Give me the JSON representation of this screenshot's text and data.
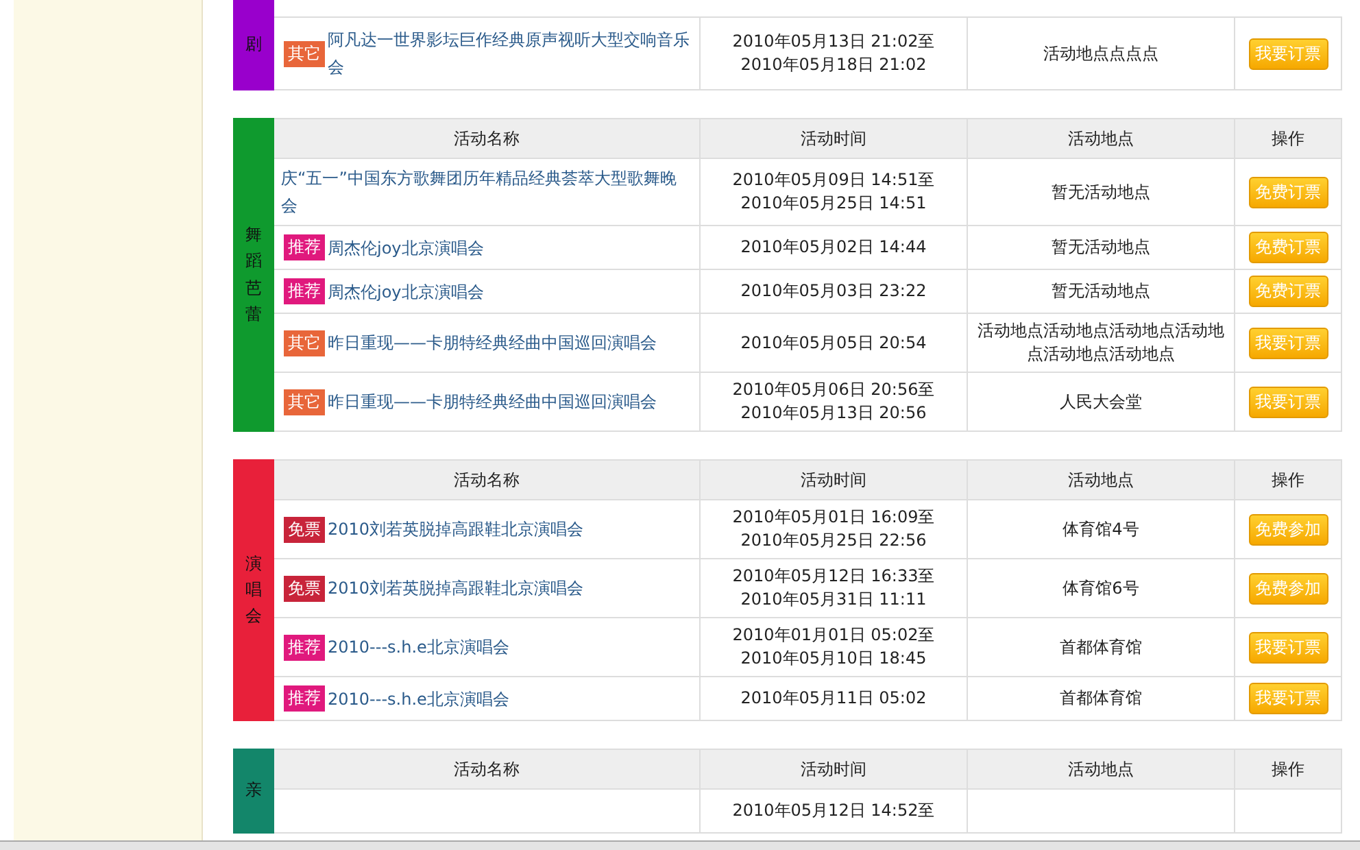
{
  "sections": [
    {
      "category": "剧",
      "color": "#9900cc",
      "rows": [
        {
          "tag": "其它",
          "color": "#e8663a",
          "name": "阿凡达一世界影坛巨作经典原声视听大型交响音乐会",
          "time": [
            "2010年05月13日 21:02至",
            "2010年05月18日 21:02"
          ],
          "place": "活动地点点点点",
          "button": "我要订票"
        }
      ]
    },
    {
      "category": "舞蹈芭蕾",
      "color": "#0f9a2e",
      "columns": [
        "活动名称",
        "活动时间",
        "活动地点",
        "操作"
      ],
      "rows": [
        {
          "name": "庆“五一”中国东方歌舞团历年精品经典荟萃大型歌舞晚会",
          "time": [
            "2010年05月09日 14:51至",
            "2010年05月25日 14:51"
          ],
          "place": "暂无活动地点",
          "button": "免费订票"
        },
        {
          "tag": "推荐",
          "color": "#e0197d",
          "name": "周杰伦joy北京演唱会",
          "time": [
            "2010年05月02日 14:44"
          ],
          "place": "暂无活动地点",
          "button": "免费订票"
        },
        {
          "tag": "推荐",
          "color": "#e0197d",
          "name": "周杰伦joy北京演唱会",
          "time": [
            "2010年05月03日 23:22"
          ],
          "place": "暂无活动地点",
          "button": "免费订票"
        },
        {
          "tag": "其它",
          "color": "#e8663a",
          "name": "昨日重现——卡朋特经典经曲中国巡回演唱会",
          "time": [
            "2010年05月05日 20:54"
          ],
          "place": "活动地点活动地点活动地点活动地点活动地点活动地点",
          "button": "我要订票"
        },
        {
          "tag": "其它",
          "color": "#e8663a",
          "name": "昨日重现——卡朋特经典经曲中国巡回演唱会",
          "time": [
            "2010年05月06日 20:56至",
            "2010年05月13日 20:56"
          ],
          "place": "人民大会堂",
          "button": "我要订票"
        }
      ]
    },
    {
      "category": "演唱会",
      "color": "#e8203a",
      "columns": [
        "活动名称",
        "活动时间",
        "活动地点",
        "操作"
      ],
      "rows": [
        {
          "tag": "免票",
          "color": "#c8243a",
          "name": "2010刘若英脱掉高跟鞋北京演唱会",
          "time": [
            "2010年05月01日 16:09至",
            "2010年05月25日 22:56"
          ],
          "place": "体育馆4号",
          "button": "免费参加"
        },
        {
          "tag": "免票",
          "color": "#c8243a",
          "name": "2010刘若英脱掉高跟鞋北京演唱会",
          "time": [
            "2010年05月12日 16:33至",
            "2010年05月31日 11:11"
          ],
          "place": "体育馆6号",
          "button": "免费参加"
        },
        {
          "tag": "推荐",
          "color": "#e0197d",
          "name": "2010---s.h.e北京演唱会",
          "time": [
            "2010年01月01日 05:02至",
            "2010年05月10日 18:45"
          ],
          "place": "首都体育馆",
          "button": "我要订票"
        },
        {
          "tag": "推荐",
          "color": "#e0197d",
          "name": "2010---s.h.e北京演唱会",
          "time": [
            "2010年05月11日 05:02"
          ],
          "place": "首都体育馆",
          "button": "我要订票"
        }
      ]
    },
    {
      "category": "亲",
      "color": "#13866a",
      "columns": [
        "活动名称",
        "活动时间",
        "活动地点",
        "操作"
      ],
      "rows": [
        {
          "time": [
            "2010年05月12日 14:52至"
          ]
        }
      ]
    }
  ]
}
